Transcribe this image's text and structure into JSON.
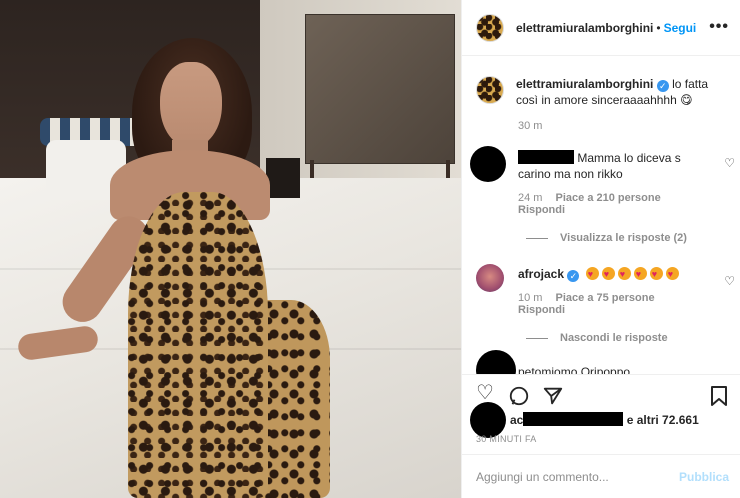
{
  "post": {
    "username": "elettramiuralamborghini",
    "follow_label": "Segui",
    "more_label": "•••",
    "caption": "lo fatta così in amore sinceraaaahhhh",
    "caption_emoji": "😋",
    "caption_time": "30 m",
    "verified_mark": "✓"
  },
  "comments": [
    {
      "user": "",
      "text": "Mamma lo diceva s",
      "text2": "carino ma non rikko",
      "time": "24 m",
      "likes": "Piace a 210 persone",
      "reply": "Rispondi",
      "replies_label": "Visualizza le risposte (2)"
    },
    {
      "user": "afrojack",
      "time": "10 m",
      "likes": "Piace a 75 persone",
      "reply": "Rispondi",
      "replies_label": "Nascondi le risposte",
      "emoji_count": 6
    }
  ],
  "likes_text": "e altri 72.661",
  "likes_prefix": "ac",
  "partial_username": "petomiomo Oripoppo",
  "time_ago": "30 MINUTI FA",
  "comment_input": {
    "placeholder": "Aggiungi un commento...",
    "publish_label": "Pubblica"
  },
  "icons": {
    "heart": "heart-outline-icon",
    "comment": "comment-icon",
    "share": "paper-plane-icon",
    "save": "bookmark-icon"
  },
  "colors": {
    "link_blue": "#0095f6",
    "publish_disabled": "#b2dffc",
    "muted_text": "#8e8e8e"
  }
}
